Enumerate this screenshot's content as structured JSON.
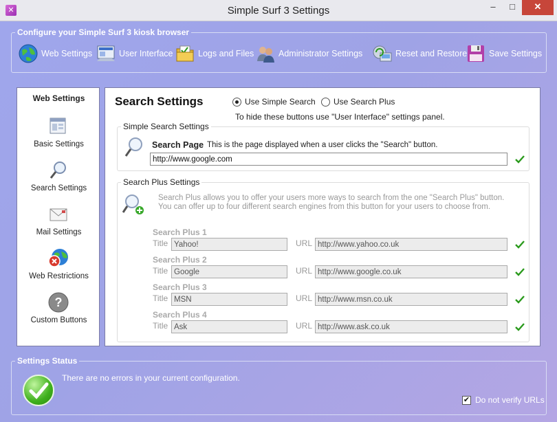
{
  "window": {
    "title": "Simple Surf 3 Settings",
    "minimize": "–",
    "maximize": "□",
    "close": "✕"
  },
  "toolbar": {
    "legend": "Configure your Simple Surf 3 kiosk browser",
    "items": [
      {
        "label": "Web Settings",
        "icon": "globe-icon"
      },
      {
        "label": "User Interface",
        "icon": "ui-monitor-icon"
      },
      {
        "label": "Logs and Files",
        "icon": "folder-icon"
      },
      {
        "label": "Administrator Settings",
        "icon": "users-icon"
      },
      {
        "label": "Reset and Restore",
        "icon": "restore-icon"
      },
      {
        "label": "Save Settings",
        "icon": "floppy-icon"
      }
    ]
  },
  "nav": {
    "title": "Web Settings",
    "items": [
      {
        "label": "Basic Settings",
        "icon": "window-icon"
      },
      {
        "label": "Search Settings",
        "icon": "magnifier-icon"
      },
      {
        "label": "Mail Settings",
        "icon": "envelope-icon"
      },
      {
        "label": "Web Restrictions",
        "icon": "restricted-globe-icon"
      },
      {
        "label": "Custom Buttons",
        "icon": "question-icon"
      }
    ]
  },
  "main": {
    "title": "Search Settings",
    "radio_simple": "Use Simple Search",
    "radio_plus": "Use Search Plus",
    "radio_selected": "simple",
    "hint": "To hide these buttons use \"User Interface\" settings panel.",
    "simple": {
      "legend": "Simple Search Settings",
      "page_label": "Search Page",
      "page_desc": "This is the page displayed when a user clicks the \"Search\" button.",
      "page_value": "http://www.google.com"
    },
    "plus": {
      "legend": "Search Plus Settings",
      "desc1": "Search Plus allows you to offer your users more ways to search from the one \"Search Plus\" button.",
      "desc2": "You can offer up to four different search engines from this button for your users to choose from.",
      "title_label": "Title",
      "url_label": "URL",
      "entries": [
        {
          "name": "Search Plus 1",
          "title": "Yahoo!",
          "url": "http://www.yahoo.co.uk"
        },
        {
          "name": "Search Plus 2",
          "title": "Google",
          "url": "http://www.google.co.uk"
        },
        {
          "name": "Search Plus 3",
          "title": "MSN",
          "url": "http://www.msn.co.uk"
        },
        {
          "name": "Search Plus 4",
          "title": "Ask",
          "url": "http://www.ask.co.uk"
        }
      ]
    }
  },
  "status": {
    "legend": "Settings Status",
    "message": "There are no errors in your current configuration.",
    "checkbox_label": "Do not verify URLs",
    "checkbox_checked": true,
    "check_mark": "✔"
  },
  "colors": {
    "accent": "#9fa6ec",
    "ok_green": "#3fb01d",
    "close_red": "#c7463a"
  }
}
